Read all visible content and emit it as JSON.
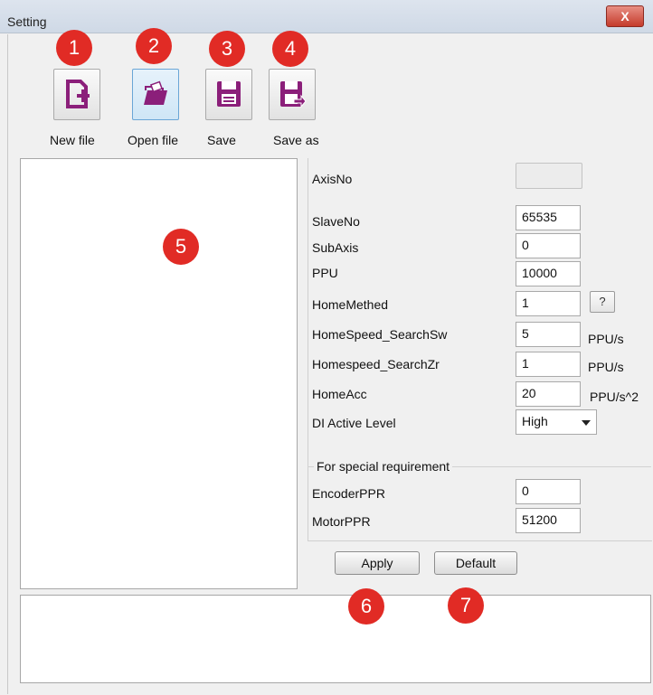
{
  "window": {
    "title": "Setting",
    "close_label": "X"
  },
  "toolbar": {
    "new_file_label": "New file",
    "open_file_label": "Open file",
    "save_label": "Save",
    "save_as_label": "Save as"
  },
  "badges": [
    "1",
    "2",
    "3",
    "4",
    "5",
    "6",
    "7"
  ],
  "params": {
    "axis_no": {
      "label": "AxisNo",
      "value": ""
    },
    "slave_no": {
      "label": "SlaveNo",
      "value": "65535"
    },
    "sub_axis": {
      "label": "SubAxis",
      "value": "0"
    },
    "ppu": {
      "label": "PPU",
      "value": "10000"
    },
    "home_method": {
      "label": "HomeMethed",
      "value": "1",
      "help": "?"
    },
    "home_speed_sw": {
      "label": "HomeSpeed_SearchSw",
      "value": "5",
      "unit": "PPU/s"
    },
    "home_speed_zr": {
      "label": "Homespeed_SearchZr",
      "value": "1",
      "unit": "PPU/s"
    },
    "home_acc": {
      "label": "HomeAcc",
      "value": "20",
      "unit": "PPU/s^2"
    },
    "di_active_level": {
      "label": "DI Active Level",
      "value": "High"
    }
  },
  "special": {
    "title": "For special requirement",
    "encoder_ppr": {
      "label": "EncoderPPR",
      "value": "0"
    },
    "motor_ppr": {
      "label": "MotorPPR",
      "value": "51200"
    }
  },
  "buttons": {
    "apply": "Apply",
    "default": "Default"
  },
  "colors": {
    "badge": "#e12b25",
    "icon_purple": "#8b1f7a"
  }
}
